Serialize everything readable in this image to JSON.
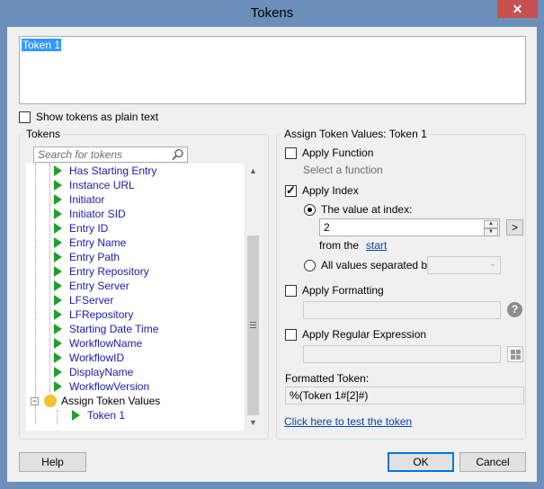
{
  "window": {
    "title": "Tokens",
    "close_glyph": "✕"
  },
  "token_text": {
    "value": "Token 1"
  },
  "show_plain": {
    "label": "Show tokens as plain text",
    "checked": false
  },
  "tokens_group": {
    "label": "Tokens",
    "search_placeholder": "Search for tokens",
    "items": [
      "Has Starting Entry",
      "Instance URL",
      "Initiator",
      "Initiator SID",
      "Entry ID",
      "Entry Name",
      "Entry Path",
      "Entry Repository",
      "Entry Server",
      "LFServer",
      "LFRepository",
      "Starting Date Time",
      "WorkflowName",
      "WorkflowID",
      "DisplayName",
      "WorkflowVersion"
    ],
    "assign_node": {
      "label": "Assign Token Values",
      "expander": "−"
    },
    "child_items": [
      "Token 1"
    ]
  },
  "assign_group": {
    "label": "Assign Token Values: Token 1",
    "apply_function": {
      "label": "Apply Function",
      "checked": false,
      "hint": "Select a function"
    },
    "apply_index": {
      "label": "Apply Index",
      "checked": true,
      "value_at_index_label": "The value at index:",
      "index_value": "2",
      "from_the_label": "from the",
      "start_link": "start",
      "more_button": ">",
      "all_values_label": "All values separated by:",
      "selected": "value_at_index"
    },
    "apply_formatting": {
      "label": "Apply Formatting",
      "checked": false,
      "value": ""
    },
    "apply_regex": {
      "label": "Apply Regular Expression",
      "checked": false,
      "value": ""
    },
    "formatted_token_label": "Formatted Token:",
    "formatted_token_value": "%(Token 1#[2]#)",
    "test_link": "Click here to test the token"
  },
  "buttons": {
    "help": "Help",
    "ok": "OK",
    "cancel": "Cancel"
  }
}
